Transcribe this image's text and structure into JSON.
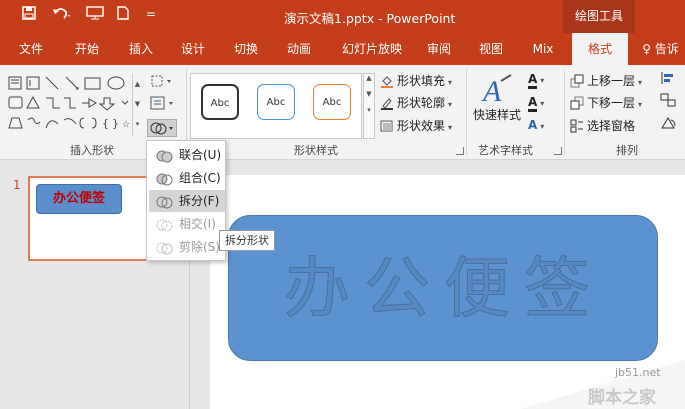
{
  "titlebar": {
    "title": "演示文稿1.pptx - PowerPoint",
    "tools_context": "绘图工具",
    "more_label": "="
  },
  "tabs": [
    {
      "label": "文件"
    },
    {
      "label": "开始"
    },
    {
      "label": "插入"
    },
    {
      "label": "设计"
    },
    {
      "label": "切换"
    },
    {
      "label": "动画"
    },
    {
      "label": "幻灯片放映"
    },
    {
      "label": "审阅"
    },
    {
      "label": "视图"
    },
    {
      "label": "Mix"
    },
    {
      "label": "格式"
    },
    {
      "label": "♀ 告诉"
    }
  ],
  "ribbon": {
    "insert_shapes": {
      "label": "插入形状"
    },
    "shape_styles": {
      "label": "形状样式",
      "gallery": [
        "Abc",
        "Abc",
        "Abc"
      ],
      "fill": "形状填充",
      "outline": "形状轮廓",
      "effects": "形状效果",
      "colors": {
        "style1": "#333333",
        "style2": "#4a90d9",
        "style3": "#ed7d31"
      }
    },
    "wordart": {
      "label": "艺术字样式",
      "quick_styles": "快速样式",
      "letter": "A"
    },
    "arrange": {
      "label": "排列",
      "bring_forward": "上移一层",
      "send_backward": "下移一层",
      "selection_pane": "选择窗格"
    }
  },
  "merge_menu": {
    "items": [
      {
        "label": "联合(U)"
      },
      {
        "label": "组合(C)"
      },
      {
        "label": "拆分(F)"
      },
      {
        "label": "相交(I)"
      },
      {
        "label": "剪除(S)"
      }
    ],
    "tooltip": "拆分形状"
  },
  "slides": {
    "number": "1",
    "thumb_text": "办公便签"
  },
  "canvas": {
    "shape_text": "办公便签"
  },
  "watermark": {
    "url": "jb51.net",
    "name": "脚本之家"
  }
}
